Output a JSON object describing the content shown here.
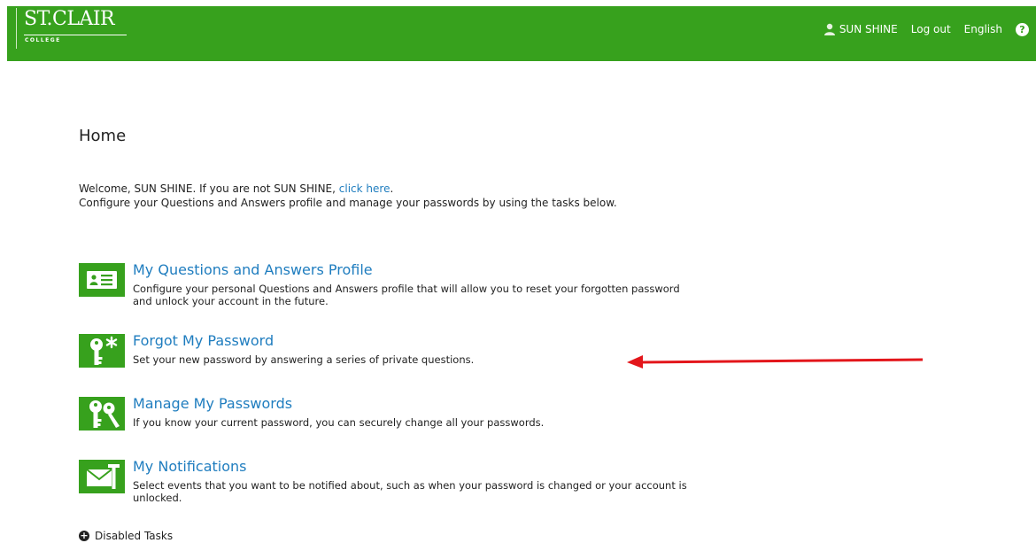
{
  "header": {
    "logo_title": "ST.CLAIR",
    "logo_sub": "COLLEGE",
    "user_name": "SUN SHINE",
    "logout_label": "Log out",
    "language_label": "English",
    "help_glyph": "?",
    "accent_color": "#37a11d"
  },
  "main": {
    "page_title": "Home",
    "welcome_prefix": "Welcome, SUN SHINE. If you are not SUN SHINE,",
    "welcome_link": "click here",
    "welcome_suffix": ".",
    "welcome_line2": "Configure your Questions and Answers profile and manage your passwords by using the tasks below.",
    "link_color": "#1f7dbf"
  },
  "tasks": [
    {
      "title": "My Questions and Answers Profile",
      "description": "Configure your personal Questions and Answers profile that will allow you to reset your forgotten password and unlock your account in the future.",
      "icon": "id-card-icon"
    },
    {
      "title": "Forgot My Password",
      "description": "Set your new password by answering a series of private questions.",
      "icon": "key-asterisk-icon"
    },
    {
      "title": "Manage My Passwords",
      "description": "If you know your current password, you can securely change all your passwords.",
      "icon": "keys-icon"
    },
    {
      "title": "My Notifications",
      "description": "Select events that you want to be notified about, such as when your password is changed or your account is unlocked.",
      "icon": "envelope-notification-icon"
    }
  ],
  "footer": {
    "disabled_tasks_label": "Disabled Tasks"
  },
  "annotation": {
    "arrow_color": "#e3161b"
  }
}
